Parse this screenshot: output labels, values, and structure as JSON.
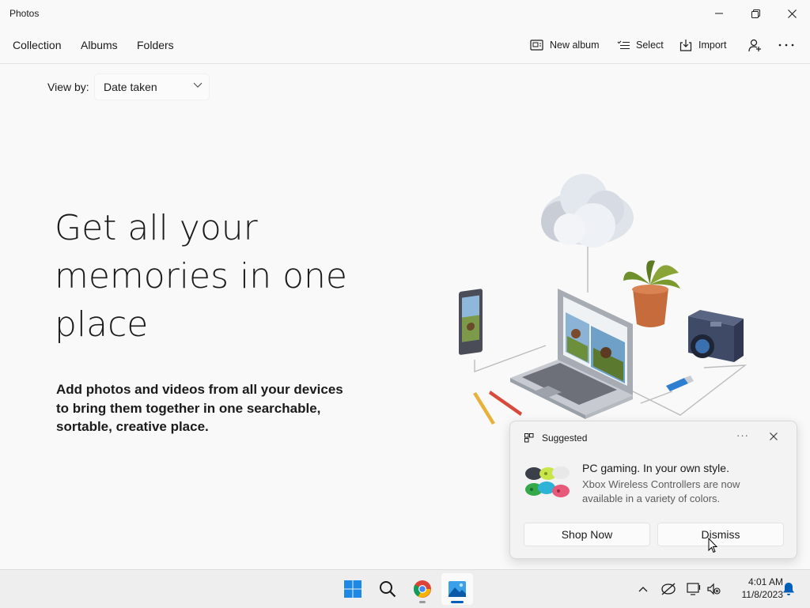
{
  "app": {
    "title": "Photos"
  },
  "nav": {
    "tabs": [
      {
        "label": "Collection"
      },
      {
        "label": "Albums"
      },
      {
        "label": "Folders"
      }
    ],
    "commands": {
      "new_album": "New album",
      "select": "Select",
      "import": "Import"
    }
  },
  "view_by": {
    "label": "View by:",
    "value": "Date taken"
  },
  "hero": {
    "title": "Get all your memories in one place",
    "subtitle": "Add photos and videos from all your devices to bring them together in one searchable, sortable, creative place."
  },
  "notification": {
    "label": "Suggested",
    "more": "···",
    "heading": "PC gaming. In your own style.",
    "body": "Xbox Wireless Controllers are now available in a variety of colors.",
    "primary_button": "Shop Now",
    "secondary_button": "Dismiss"
  },
  "taskbar": {
    "time": "4:01 AM",
    "date": "11/8/2023"
  },
  "colors": {
    "accent": "#005fb8",
    "background": "#f9f9f9",
    "taskbar": "#eeeeee"
  },
  "icons": [
    "minimize-icon",
    "maximize-icon",
    "close-icon",
    "new-album-icon",
    "select-icon",
    "import-icon",
    "add-person-icon",
    "more-icon",
    "chevron-down-icon",
    "windows-start-icon",
    "search-icon",
    "chrome-icon",
    "photos-icon",
    "chevron-up-icon",
    "network-icon",
    "display-icon",
    "volume-icon",
    "notification-bell-icon"
  ]
}
